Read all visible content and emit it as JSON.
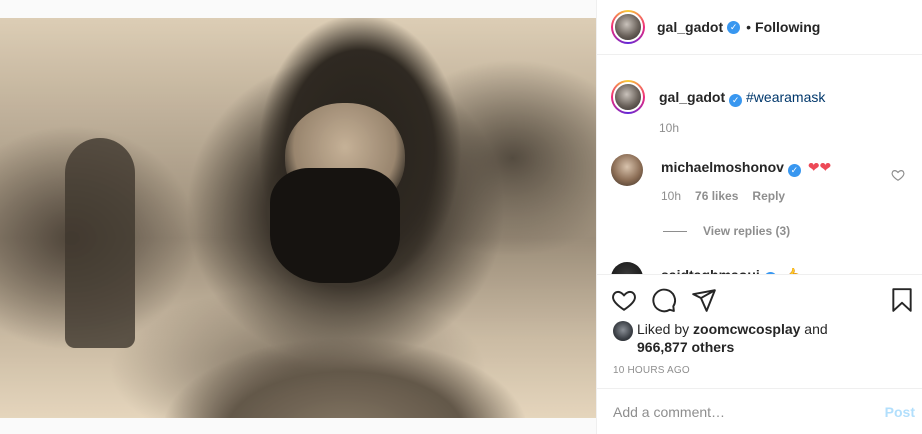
{
  "post": {
    "image": {
      "kind": "photo",
      "tone": "sepia"
    }
  },
  "header": {
    "username": "gal_gadot",
    "verified_icon": "verified-badge-icon",
    "separator": "•",
    "follow_state": "Following"
  },
  "caption": {
    "username": "gal_gadot",
    "text": "#wearamask",
    "time": "10h"
  },
  "comments": [
    {
      "username": "michaelmoshonov",
      "text": "❤❤",
      "time": "10h",
      "likes": "76 likes",
      "reply_label": "Reply",
      "view_replies": "View replies (3)"
    },
    {
      "username": "saidtaghmaoui",
      "text": "👍"
    }
  ],
  "actions": {
    "like_icon": "heart-icon",
    "comment_icon": "comment-icon",
    "share_icon": "share-icon",
    "save_icon": "bookmark-icon"
  },
  "likes": {
    "prefix": "Liked by ",
    "liker": "zoomcwcosplay",
    "and": " and",
    "count": "966,877 others"
  },
  "timestamp": "10 HOURS AGO",
  "comment_box": {
    "placeholder": "Add a comment…",
    "post_label": "Post"
  },
  "colors": {
    "link": "#00376b",
    "verified": "#3897f0",
    "muted": "#8e8e8e",
    "post_disabled": "#b2dffc",
    "heart": "#ed4956"
  }
}
